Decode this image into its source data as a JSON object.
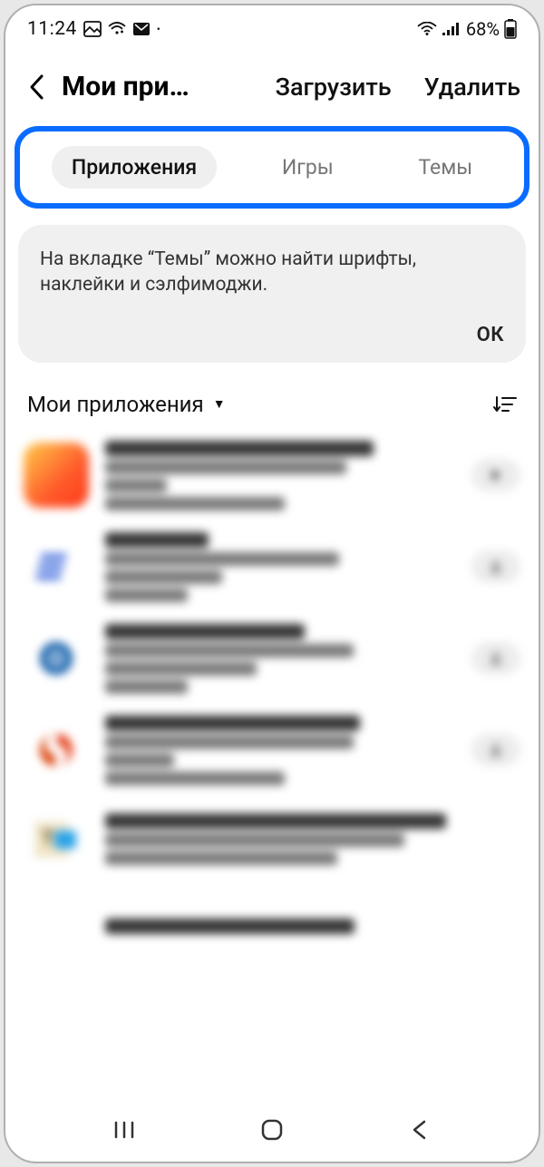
{
  "status": {
    "time": "11:24",
    "battery": "68%"
  },
  "header": {
    "title": "Мои при…",
    "action_download": "Загрузить",
    "action_delete": "Удалить"
  },
  "tabs": {
    "apps": "Приложения",
    "games": "Игры",
    "themes": "Темы"
  },
  "info": {
    "text": "На вкладке “Темы” можно найти шрифты, наклейки и сэлфимоджи.",
    "ok": "ОК"
  },
  "section": {
    "title": "Мои приложения"
  },
  "apps": [
    {
      "title_w": "78%",
      "l2_w": "70%",
      "l3_w": "18%",
      "l4_w": "52%",
      "action": "play",
      "icon": "icon-0"
    },
    {
      "title_w": "30%",
      "l2_w": "68%",
      "l3_w": "34%",
      "l4_w": "24%",
      "action": "download",
      "icon": "icon-1"
    },
    {
      "title_w": "58%",
      "l2_w": "72%",
      "l3_w": "44%",
      "l4_w": "24%",
      "action": "download",
      "icon": "icon-2"
    },
    {
      "title_w": "74%",
      "l2_w": "72%",
      "l3_w": "20%",
      "l4_w": "52%",
      "action": "download",
      "icon": "icon-3"
    },
    {
      "title_w": "82%",
      "l2_w": "72%",
      "l3_w": "56%",
      "l4_w": "0%",
      "action": "none",
      "icon": "icon-4"
    },
    {
      "title_w": "60%",
      "l2_w": "0%",
      "l3_w": "0%",
      "l4_w": "0%",
      "action": "none",
      "icon": "icon-x"
    }
  ]
}
